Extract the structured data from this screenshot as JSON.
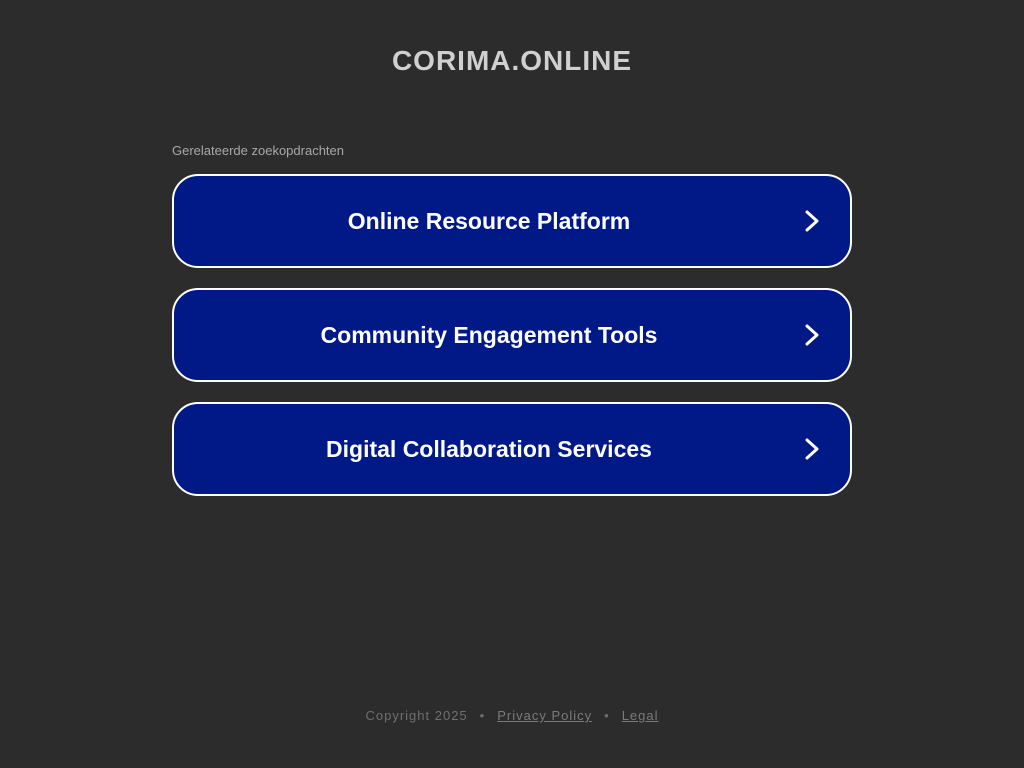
{
  "header": {
    "site_title": "CORIMA.ONLINE"
  },
  "related": {
    "label": "Gerelateerde zoekopdrachten",
    "items": [
      {
        "label": "Online Resource Platform",
        "icon": "chevron-right-icon"
      },
      {
        "label": "Community Engagement Tools",
        "icon": "chevron-right-icon"
      },
      {
        "label": "Digital Collaboration Services",
        "icon": "chevron-right-icon"
      }
    ]
  },
  "footer": {
    "copyright": "Copyright 2025",
    "separator": "•",
    "privacy_label": "Privacy Policy",
    "legal_label": "Legal"
  },
  "colors": {
    "background": "#2c2c2c",
    "button_fill": "#011887",
    "button_border": "#ffffff"
  }
}
